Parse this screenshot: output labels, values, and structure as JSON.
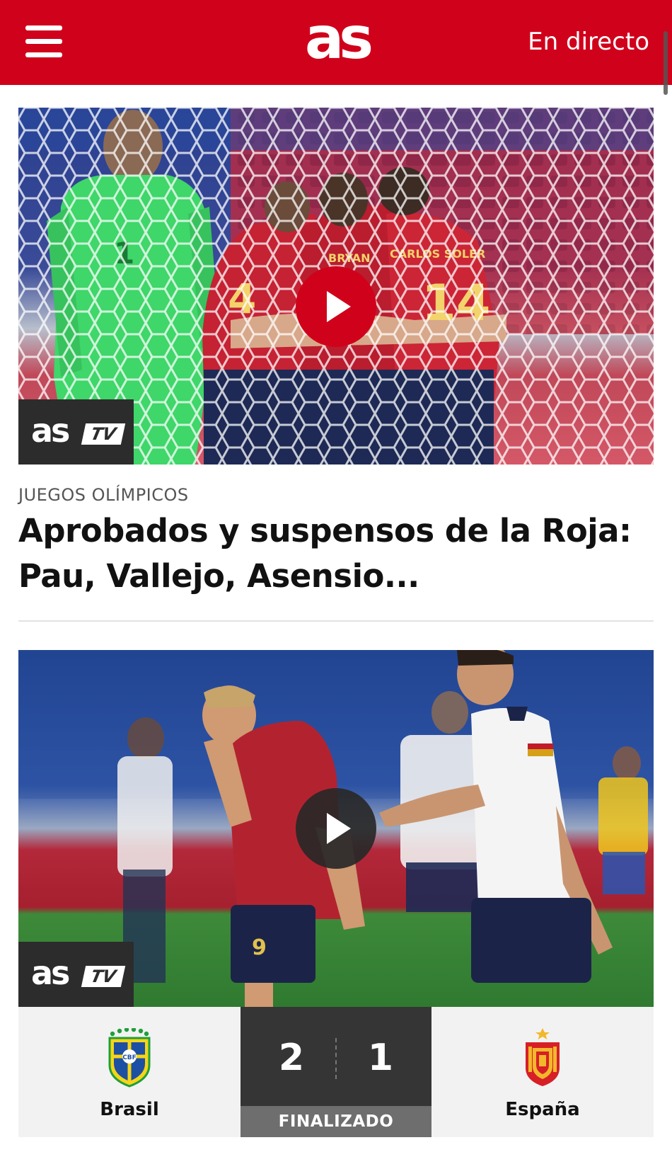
{
  "header": {
    "logo": "as",
    "live_label": "En directo"
  },
  "article1": {
    "video_badge": {
      "as": "as",
      "tv": "TV"
    },
    "section": "JUEGOS OLÍMPICOS",
    "headline": "Aprobados y suspensos de la Roja: Pau, Vallejo, Asensio..."
  },
  "article2": {
    "video_badge": {
      "as": "as",
      "tv": "TV"
    }
  },
  "match": {
    "home_team": "Brasil",
    "away_team": "España",
    "home_score": "2",
    "away_score": "1",
    "status": "FINALIZADO"
  },
  "colors": {
    "brand_red": "#d0021b",
    "scoreboard_dark": "#353535",
    "status_grey": "#6e6e6e"
  },
  "icons": [
    "menu-icon",
    "play-icon",
    "brasil-crest-icon",
    "espana-crest-icon"
  ]
}
